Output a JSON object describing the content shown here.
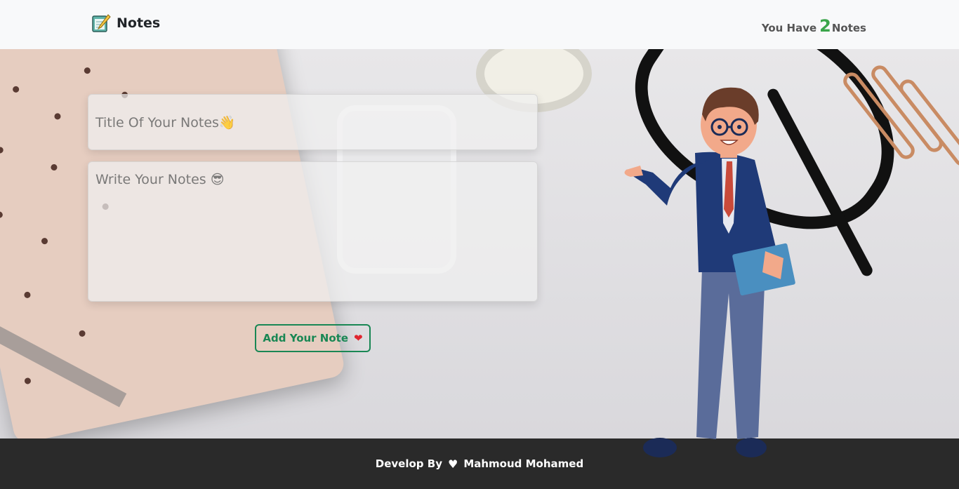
{
  "navbar": {
    "brand_label": "Notes",
    "count_prefix": "You Have",
    "count_value": "2",
    "count_suffix": "Notes"
  },
  "form": {
    "title_placeholder": "Title Of Your Notes👋",
    "notes_placeholder": "Write Your Notes 😎",
    "add_button_label": "Add Your Note",
    "add_button_icon": "heart-icon"
  },
  "footer": {
    "prefix": "Develop By",
    "icon": "white-heart-icon",
    "author": "Mahmoud Mohamed"
  },
  "colors": {
    "accent_green": "#198754",
    "count_green": "#3aa54a",
    "footer_bg": "#2a2a2a",
    "navbar_bg": "#f8f9fa"
  }
}
